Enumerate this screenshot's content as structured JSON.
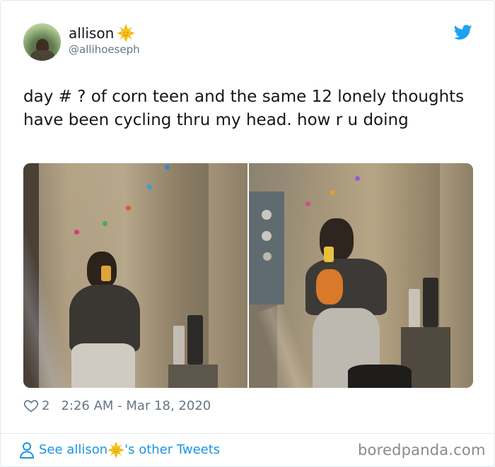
{
  "author": {
    "name": "allison",
    "name_emoji": "sun-with-face-emoji",
    "handle": "@allihoeseph"
  },
  "tweet": {
    "text": "day # ? of corn teen and the same 12 lonely thoughts have been cycling thru my head. how r u doing",
    "likes": "2",
    "timestamp": "2:26 AM - Mar 18, 2020"
  },
  "footer": {
    "see_prefix": "See allison",
    "see_suffix": "'s other Tweets"
  },
  "watermark": "boredpanda.com",
  "colors": {
    "link": "#1b95e0",
    "secondary_text": "#657786",
    "border": "#e1e8ed",
    "sun": "#f5b400"
  }
}
